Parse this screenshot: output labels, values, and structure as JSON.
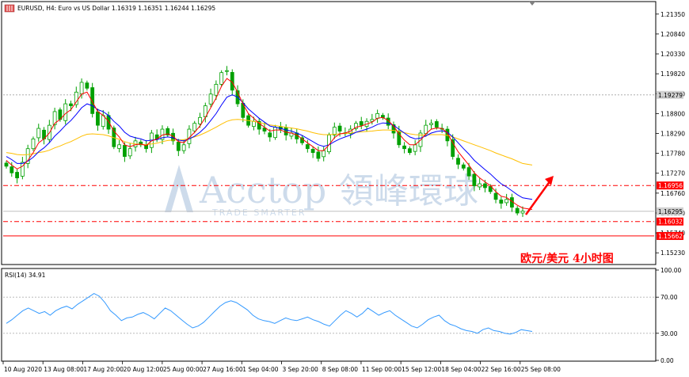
{
  "header": {
    "symbol_line": "EURUSD, H4:  Euro vs US Dollar  1.16319 1.16351 1.16244 1.16295"
  },
  "watermark": {
    "brand": "Acctop",
    "brand_cn": "領峰環球",
    "tagline": "TRADE SMARTER"
  },
  "annotation": {
    "title": "欧元/美元  4小时图"
  },
  "colors": {
    "candle": "#00a000",
    "ma_fast": "#ff0000",
    "ma_mid": "#0000ff",
    "ma_slow": "#ffbf00",
    "rsi_line": "#3399ff",
    "level_line": "#ff0000",
    "current_line": "#c0c0c0",
    "arrow": "#ff0000"
  },
  "chart_data": {
    "type": "candlestick",
    "symbol": "EURUSD",
    "timeframe": "H4",
    "ohlc_last": {
      "open": 1.16319,
      "high": 1.16351,
      "low": 1.16244,
      "close": 1.16295
    },
    "y_axis_ticks": [
      "1.21350",
      "1.20840",
      "1.20330",
      "1.19820",
      "1.19310",
      "1.18800",
      "1.18290",
      "1.17780",
      "1.17270",
      "1.16760",
      "1.16250",
      "1.15740",
      "1.15230"
    ],
    "ylim": [
      1.1495,
      1.2163
    ],
    "x_axis_ticks": [
      "10 Aug 2020",
      "13 Aug 08:00",
      "17 Aug 20:00",
      "20 Aug 12:00",
      "25 Aug 00:00",
      "27 Aug 16:00",
      "1 Sep 04:00",
      "3 Sep 20:00",
      "8 Sep 08:00",
      "11 Sep 00:00",
      "15 Sep 12:00",
      "18 Sep 04:00",
      "22 Sep 16:00",
      "25 Sep 08:00"
    ],
    "close_path": [
      1.1745,
      1.1728,
      1.1715,
      1.1755,
      1.179,
      1.1815,
      1.1842,
      1.1815,
      1.185,
      1.1885,
      1.1865,
      1.1905,
      1.19,
      1.1935,
      1.196,
      1.1945,
      1.188,
      1.185,
      1.1875,
      1.184,
      1.1795,
      1.18,
      1.177,
      1.179,
      1.181,
      1.18,
      1.179,
      1.183,
      1.1815,
      1.184,
      1.1825,
      1.181,
      1.1785,
      1.18,
      1.184,
      1.1855,
      1.187,
      1.19,
      1.193,
      1.1955,
      1.1985,
      1.199,
      1.194,
      1.1905,
      1.187,
      1.185,
      1.186,
      1.184,
      1.1835,
      1.182,
      1.1845,
      1.184,
      1.1825,
      1.183,
      1.1815,
      1.1805,
      1.179,
      1.178,
      1.1765,
      1.1785,
      1.1825,
      1.1845,
      1.1835,
      1.183,
      1.184,
      1.1855,
      1.185,
      1.186,
      1.1865,
      1.188,
      1.187,
      1.185,
      1.183,
      1.18,
      1.179,
      1.178,
      1.18,
      1.183,
      1.185,
      1.1855,
      1.1845,
      1.184,
      1.181,
      1.177,
      1.175,
      1.174,
      1.172,
      1.1695,
      1.17,
      1.169,
      1.168,
      1.166,
      1.165,
      1.166,
      1.164,
      1.1625,
      1.163
    ],
    "ma_fast_path": [
      1.176,
      1.1748,
      1.1738,
      1.1745,
      1.176,
      1.178,
      1.1805,
      1.1815,
      1.183,
      1.1855,
      1.1865,
      1.188,
      1.189,
      1.191,
      1.193,
      1.1935,
      1.191,
      1.1885,
      1.1875,
      1.186,
      1.1835,
      1.182,
      1.18,
      1.1795,
      1.18,
      1.1802,
      1.1798,
      1.181,
      1.1815,
      1.1825,
      1.1828,
      1.1822,
      1.1808,
      1.1805,
      1.1818,
      1.1832,
      1.1848,
      1.187,
      1.1895,
      1.192,
      1.195,
      1.197,
      1.196,
      1.1935,
      1.1905,
      1.188,
      1.1868,
      1.1855,
      1.1845,
      1.1835,
      1.1838,
      1.1838,
      1.1832,
      1.183,
      1.1825,
      1.1815,
      1.1805,
      1.1795,
      1.1785,
      1.1785,
      1.18,
      1.1818,
      1.1828,
      1.183,
      1.1835,
      1.1845,
      1.1848,
      1.1853,
      1.1858,
      1.1868,
      1.187,
      1.1862,
      1.1848,
      1.1828,
      1.1812,
      1.18,
      1.18,
      1.1812,
      1.1828,
      1.184,
      1.1843,
      1.1842,
      1.183,
      1.1805,
      1.1782,
      1.1765,
      1.1748,
      1.1728,
      1.1715,
      1.1705,
      1.1695,
      1.168,
      1.1668,
      1.1665,
      1.1655,
      1.1645,
      1.1638
    ],
    "ma_mid_path": [
      1.177,
      1.1762,
      1.1752,
      1.1752,
      1.1758,
      1.1768,
      1.1782,
      1.1792,
      1.1805,
      1.1822,
      1.1835,
      1.185,
      1.1862,
      1.1878,
      1.1895,
      1.1905,
      1.19,
      1.189,
      1.1885,
      1.1875,
      1.186,
      1.1848,
      1.1832,
      1.1822,
      1.1818,
      1.1815,
      1.181,
      1.1812,
      1.1813,
      1.1818,
      1.182,
      1.1818,
      1.1812,
      1.181,
      1.1815,
      1.1822,
      1.1832,
      1.1845,
      1.1862,
      1.188,
      1.1902,
      1.1922,
      1.1928,
      1.1922,
      1.1908,
      1.1892,
      1.188,
      1.1868,
      1.1858,
      1.1848,
      1.1845,
      1.1842,
      1.1838,
      1.1835,
      1.183,
      1.1824,
      1.1816,
      1.1808,
      1.18,
      1.1796,
      1.18,
      1.1808,
      1.1815,
      1.182,
      1.1825,
      1.1832,
      1.1836,
      1.184,
      1.1845,
      1.1852,
      1.1856,
      1.1855,
      1.185,
      1.184,
      1.183,
      1.182,
      1.1815,
      1.1817,
      1.1823,
      1.183,
      1.1834,
      1.1836,
      1.1832,
      1.182,
      1.1805,
      1.179,
      1.1776,
      1.176,
      1.1748,
      1.1736,
      1.1725,
      1.1712,
      1.17,
      1.1692,
      1.1682,
      1.1672,
      1.1664
    ],
    "ma_slow_path": [
      1.178,
      1.1778,
      1.1775,
      1.1774,
      1.1775,
      1.1777,
      1.178,
      1.1782,
      1.1786,
      1.1792,
      1.1797,
      1.1803,
      1.1808,
      1.1815,
      1.1822,
      1.1827,
      1.1828,
      1.1827,
      1.1826,
      1.1823,
      1.1818,
      1.1814,
      1.1808,
      1.1804,
      1.1802,
      1.1801,
      1.18,
      1.1802,
      1.1804,
      1.1808,
      1.1811,
      1.1812,
      1.1812,
      1.1813,
      1.1816,
      1.182,
      1.1825,
      1.1831,
      1.1838,
      1.1845,
      1.1853,
      1.186,
      1.1864,
      1.1865,
      1.1864,
      1.1862,
      1.186,
      1.1857,
      1.1854,
      1.1851,
      1.1849,
      1.1847,
      1.1845,
      1.1843,
      1.1841,
      1.1838,
      1.1835,
      1.1831,
      1.1828,
      1.1826,
      1.1826,
      1.1827,
      1.1828,
      1.1829,
      1.183,
      1.1832,
      1.1833,
      1.1834,
      1.1835,
      1.1837,
      1.1838,
      1.1838,
      1.1837,
      1.1834,
      1.1831,
      1.1828,
      1.1826,
      1.1825,
      1.1825,
      1.1826,
      1.1826,
      1.1826,
      1.1824,
      1.182,
      1.1815,
      1.181,
      1.1805,
      1.18,
      1.1795,
      1.179,
      1.1785,
      1.1779,
      1.1774,
      1.1769,
      1.1764,
      1.1758,
      1.1752
    ],
    "price_labels": [
      {
        "price": 1.19279,
        "text": "1.19279",
        "style": "gray"
      },
      {
        "price": 1.16956,
        "text": "1.16956",
        "style": "red"
      },
      {
        "price": 1.16295,
        "text": "1.16295",
        "style": "gray"
      },
      {
        "price": 1.16032,
        "text": "1.16032",
        "style": "red"
      },
      {
        "price": 1.15662,
        "text": "1.15662",
        "style": "red"
      }
    ],
    "levels": [
      {
        "price": 1.16956,
        "style": "dashdot"
      },
      {
        "price": 1.16032,
        "style": "dashdot"
      },
      {
        "price": 1.15662,
        "style": "solid"
      }
    ],
    "rsi": {
      "label": "RSI(14) 34.91",
      "value": 34.91,
      "ylim": [
        0,
        100
      ],
      "ticks": [
        "100.00",
        "70.00",
        "30.00",
        "0.00"
      ],
      "levels": [
        70,
        30
      ],
      "values": [
        41,
        45,
        50,
        55,
        58,
        55,
        52,
        54,
        50,
        55,
        58,
        60,
        57,
        62,
        66,
        70,
        74,
        71,
        64,
        55,
        50,
        44,
        47,
        48,
        51,
        53,
        50,
        46,
        52,
        58,
        55,
        50,
        45,
        40,
        36,
        38,
        42,
        48,
        54,
        60,
        64,
        66,
        64,
        60,
        56,
        50,
        46,
        44,
        43,
        41,
        44,
        47,
        45,
        44,
        46,
        48,
        45,
        43,
        40,
        38,
        44,
        50,
        55,
        52,
        48,
        52,
        58,
        54,
        50,
        53,
        55,
        50,
        46,
        42,
        38,
        36,
        40,
        45,
        48,
        50,
        44,
        40,
        38,
        35,
        33,
        32,
        30,
        34,
        36,
        33,
        32,
        30,
        29,
        31,
        34,
        33,
        32
      ]
    }
  }
}
